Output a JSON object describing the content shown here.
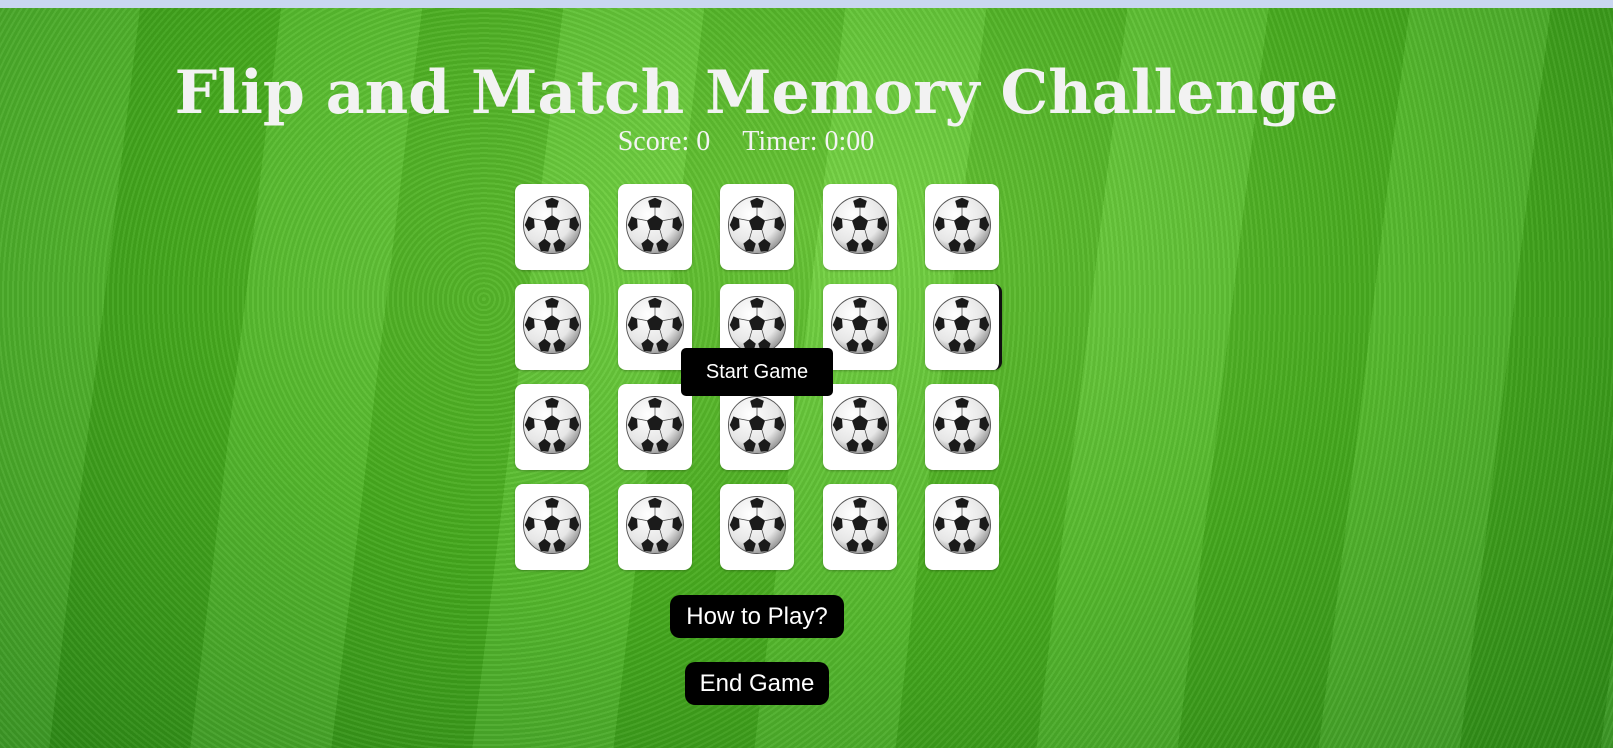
{
  "header": {
    "title": "Flip and Match Memory Challenge",
    "score_text": "Score: 0",
    "timer_text": "Timer: 0:00"
  },
  "board": {
    "rows": 4,
    "columns": 5,
    "card_face": "soccer-ball-icon"
  },
  "buttons": {
    "start_label": "Start Game",
    "howto_label": "How to Play?",
    "end_label": "End Game"
  },
  "colors": {
    "background": "#4caf26",
    "text": "#f2f2f2",
    "button_bg": "#000000",
    "card_bg": "#ffffff"
  }
}
